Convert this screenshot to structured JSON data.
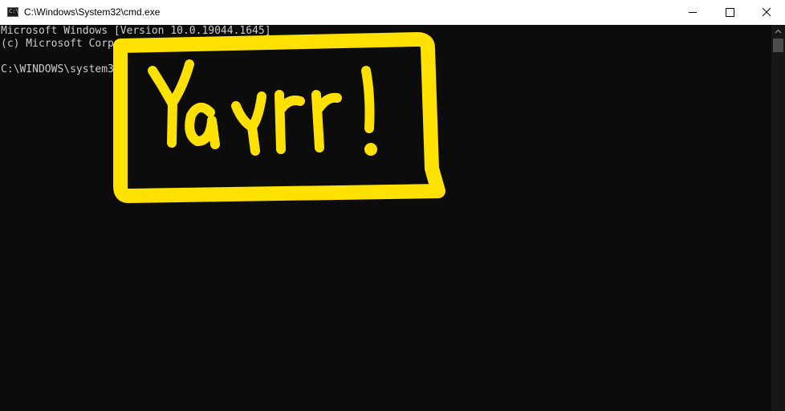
{
  "window": {
    "title": "C:\\Windows\\System32\\cmd.exe",
    "icon_label": "C:\\",
    "app_icon": "cmd-icon",
    "controls": {
      "minimize_icon": "minimize-icon",
      "maximize_icon": "maximize-icon",
      "close_icon": "close-icon"
    }
  },
  "console": {
    "line1": "Microsoft Windows [Version 10.0.19044.1645]",
    "line2": "(c) Microsoft Corporation. All rights reserved.",
    "line4": "C:\\WINDOWS\\system32>"
  },
  "annotation": {
    "text": "Yayrr!",
    "color": "#ffe100"
  },
  "colors": {
    "console_bg": "#0c0c0c",
    "console_text": "#cccccc",
    "titlebar_bg": "#ffffff"
  }
}
